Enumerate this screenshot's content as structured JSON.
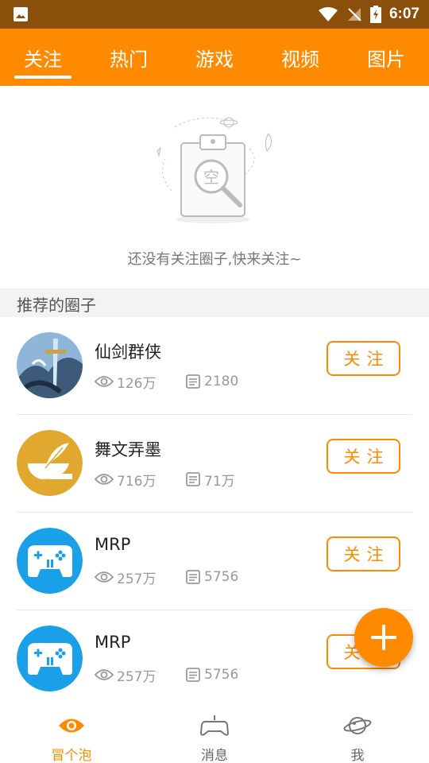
{
  "status_bar": {
    "time": "6:07"
  },
  "tabs": [
    {
      "label": "关注",
      "active": true
    },
    {
      "label": "热门"
    },
    {
      "label": "游戏"
    },
    {
      "label": "视频"
    },
    {
      "label": "图片"
    }
  ],
  "empty_state": {
    "illustration_text": "空",
    "message": "还没有关注圈子,快来关注~"
  },
  "section": {
    "title": "推荐的圈子"
  },
  "circles": [
    {
      "name": "仙剑群侠",
      "views": "126万",
      "posts": "2180",
      "follow_label": "关注"
    },
    {
      "name": "舞文弄墨",
      "views": "716万",
      "posts": "71万",
      "follow_label": "关注"
    },
    {
      "name": "MRP",
      "views": "257万",
      "posts": "5756",
      "follow_label": "关注"
    },
    {
      "name": "MRP",
      "views": "257万",
      "posts": "5756",
      "follow_label": "关注"
    }
  ],
  "bottom_nav": [
    {
      "label": "冒个泡",
      "icon": "eye-icon",
      "active": true
    },
    {
      "label": "消息",
      "icon": "gamepad-icon"
    },
    {
      "label": "我",
      "icon": "planet-icon"
    }
  ],
  "colors": {
    "accent": "#ff8a00",
    "status_bar": "#8a4f0a"
  }
}
